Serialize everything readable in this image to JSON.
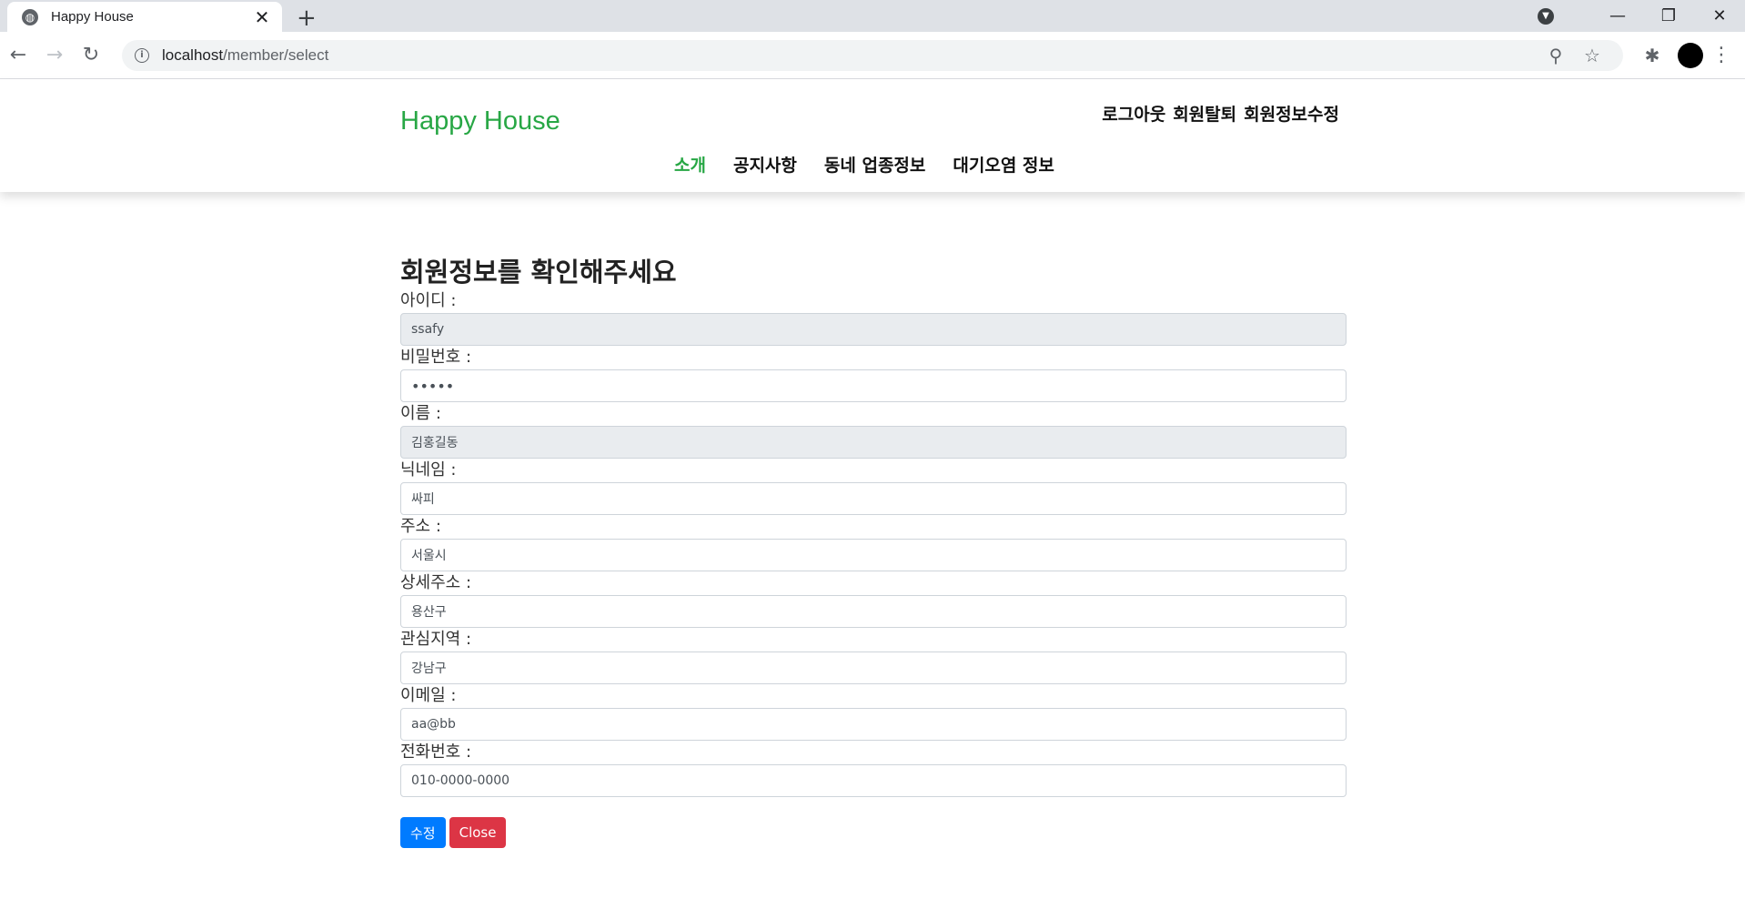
{
  "browser": {
    "tab_title": "Happy House",
    "url_host": "localhost",
    "url_path": "/member/select"
  },
  "site": {
    "brand": "Happy House",
    "top_menu": {
      "logout": "로그아웃",
      "withdraw": "회원탈퇴",
      "edit_profile": "회원정보수정"
    },
    "nav": {
      "intro": "소개",
      "notice": "공지사항",
      "business": "동네 업종정보",
      "air": "대기오염 정보"
    }
  },
  "form": {
    "heading": "회원정보를 확인해주세요",
    "id_label": "아이디 :",
    "id_value": "ssafy",
    "password_label": "비밀번호 :",
    "password_value": "ssafy",
    "name_label": "이름 :",
    "name_value": "김홍길동",
    "nickname_label": "닉네임 :",
    "nickname_value": "싸피",
    "address_label": "주소 :",
    "address_value": "서울시",
    "detail_address_label": "상세주소 :",
    "detail_address_value": "용산구",
    "interest_label": "관심지역 :",
    "interest_value": "강남구",
    "email_label": "이메일 :",
    "email_value": "aa@bb",
    "phone_label": "전화번호 :",
    "phone_value": "010-0000-0000",
    "submit_label": "수정",
    "close_label": "Close"
  },
  "colors": {
    "brand_green": "#28a745",
    "primary": "#007bff",
    "danger": "#dc3545"
  }
}
